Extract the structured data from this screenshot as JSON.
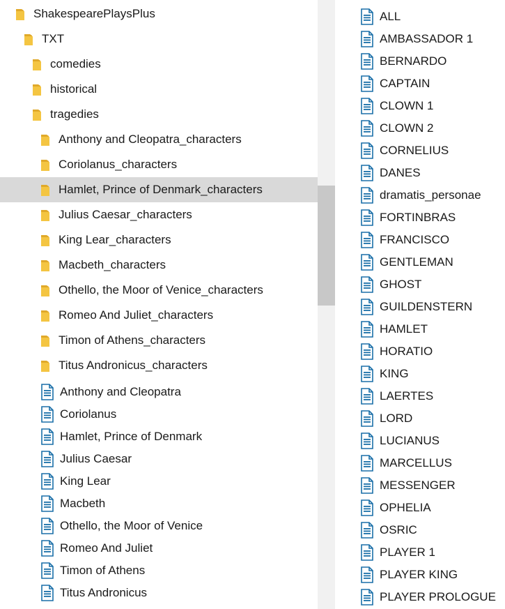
{
  "tree": {
    "root": "ShakespearePlaysPlus",
    "txt": "TXT",
    "genre_folders": [
      "comedies",
      "historical",
      "tragedies"
    ],
    "character_folders": [
      "Anthony and Cleopatra_characters",
      "Coriolanus_characters",
      "Hamlet, Prince of Denmark_characters",
      "Julius Caesar_characters",
      "King Lear_characters",
      "Macbeth_characters",
      "Othello, the Moor of Venice_characters",
      "Romeo And Juliet_characters",
      "Timon of Athens_characters",
      "Titus Andronicus_characters"
    ],
    "play_files": [
      "Anthony and Cleopatra",
      "Coriolanus",
      "Hamlet, Prince of Denmark",
      "Julius Caesar",
      "King Lear",
      "Macbeth",
      "Othello, the Moor of Venice",
      "Romeo And Juliet",
      "Timon of Athens",
      "Titus Andronicus"
    ]
  },
  "files": [
    "ALL",
    "AMBASSADOR 1",
    "BERNARDO",
    "CAPTAIN",
    "CLOWN 1",
    "CLOWN 2",
    "CORNELIUS",
    "DANES",
    "dramatis_personae",
    "FORTINBRAS",
    "FRANCISCO",
    "GENTLEMAN",
    "GHOST",
    "GUILDENSTERN",
    "HAMLET",
    "HORATIO",
    "KING",
    "LAERTES",
    "LORD",
    "LUCIANUS",
    "MARCELLUS",
    "MESSENGER",
    "OPHELIA",
    "OSRIC",
    "PLAYER 1",
    "PLAYER KING",
    "PLAYER PROLOGUE"
  ],
  "colors": {
    "folder": "#f4c542",
    "folder_dark": "#e0a92a",
    "doc_stroke": "#1a6fa8",
    "selection": "#d9d9d9",
    "scroll_thumb": "#c8c8c8",
    "scroll_track": "#f1f1f1"
  },
  "icons": {
    "folder": "folder-icon",
    "document": "text-document-icon"
  }
}
